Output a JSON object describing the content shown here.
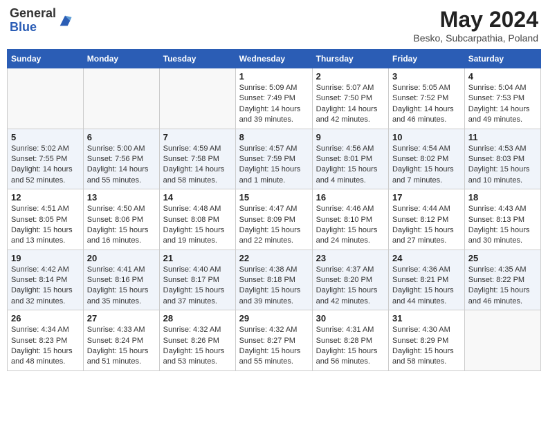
{
  "header": {
    "logo_general": "General",
    "logo_blue": "Blue",
    "month_year": "May 2024",
    "location": "Besko, Subcarpathia, Poland"
  },
  "weekdays": [
    "Sunday",
    "Monday",
    "Tuesday",
    "Wednesday",
    "Thursday",
    "Friday",
    "Saturday"
  ],
  "weeks": [
    [
      {
        "day": "",
        "info": ""
      },
      {
        "day": "",
        "info": ""
      },
      {
        "day": "",
        "info": ""
      },
      {
        "day": "1",
        "info": "Sunrise: 5:09 AM\nSunset: 7:49 PM\nDaylight: 14 hours and 39 minutes."
      },
      {
        "day": "2",
        "info": "Sunrise: 5:07 AM\nSunset: 7:50 PM\nDaylight: 14 hours and 42 minutes."
      },
      {
        "day": "3",
        "info": "Sunrise: 5:05 AM\nSunset: 7:52 PM\nDaylight: 14 hours and 46 minutes."
      },
      {
        "day": "4",
        "info": "Sunrise: 5:04 AM\nSunset: 7:53 PM\nDaylight: 14 hours and 49 minutes."
      }
    ],
    [
      {
        "day": "5",
        "info": "Sunrise: 5:02 AM\nSunset: 7:55 PM\nDaylight: 14 hours and 52 minutes."
      },
      {
        "day": "6",
        "info": "Sunrise: 5:00 AM\nSunset: 7:56 PM\nDaylight: 14 hours and 55 minutes."
      },
      {
        "day": "7",
        "info": "Sunrise: 4:59 AM\nSunset: 7:58 PM\nDaylight: 14 hours and 58 minutes."
      },
      {
        "day": "8",
        "info": "Sunrise: 4:57 AM\nSunset: 7:59 PM\nDaylight: 15 hours and 1 minute."
      },
      {
        "day": "9",
        "info": "Sunrise: 4:56 AM\nSunset: 8:01 PM\nDaylight: 15 hours and 4 minutes."
      },
      {
        "day": "10",
        "info": "Sunrise: 4:54 AM\nSunset: 8:02 PM\nDaylight: 15 hours and 7 minutes."
      },
      {
        "day": "11",
        "info": "Sunrise: 4:53 AM\nSunset: 8:03 PM\nDaylight: 15 hours and 10 minutes."
      }
    ],
    [
      {
        "day": "12",
        "info": "Sunrise: 4:51 AM\nSunset: 8:05 PM\nDaylight: 15 hours and 13 minutes."
      },
      {
        "day": "13",
        "info": "Sunrise: 4:50 AM\nSunset: 8:06 PM\nDaylight: 15 hours and 16 minutes."
      },
      {
        "day": "14",
        "info": "Sunrise: 4:48 AM\nSunset: 8:08 PM\nDaylight: 15 hours and 19 minutes."
      },
      {
        "day": "15",
        "info": "Sunrise: 4:47 AM\nSunset: 8:09 PM\nDaylight: 15 hours and 22 minutes."
      },
      {
        "day": "16",
        "info": "Sunrise: 4:46 AM\nSunset: 8:10 PM\nDaylight: 15 hours and 24 minutes."
      },
      {
        "day": "17",
        "info": "Sunrise: 4:44 AM\nSunset: 8:12 PM\nDaylight: 15 hours and 27 minutes."
      },
      {
        "day": "18",
        "info": "Sunrise: 4:43 AM\nSunset: 8:13 PM\nDaylight: 15 hours and 30 minutes."
      }
    ],
    [
      {
        "day": "19",
        "info": "Sunrise: 4:42 AM\nSunset: 8:14 PM\nDaylight: 15 hours and 32 minutes."
      },
      {
        "day": "20",
        "info": "Sunrise: 4:41 AM\nSunset: 8:16 PM\nDaylight: 15 hours and 35 minutes."
      },
      {
        "day": "21",
        "info": "Sunrise: 4:40 AM\nSunset: 8:17 PM\nDaylight: 15 hours and 37 minutes."
      },
      {
        "day": "22",
        "info": "Sunrise: 4:38 AM\nSunset: 8:18 PM\nDaylight: 15 hours and 39 minutes."
      },
      {
        "day": "23",
        "info": "Sunrise: 4:37 AM\nSunset: 8:20 PM\nDaylight: 15 hours and 42 minutes."
      },
      {
        "day": "24",
        "info": "Sunrise: 4:36 AM\nSunset: 8:21 PM\nDaylight: 15 hours and 44 minutes."
      },
      {
        "day": "25",
        "info": "Sunrise: 4:35 AM\nSunset: 8:22 PM\nDaylight: 15 hours and 46 minutes."
      }
    ],
    [
      {
        "day": "26",
        "info": "Sunrise: 4:34 AM\nSunset: 8:23 PM\nDaylight: 15 hours and 48 minutes."
      },
      {
        "day": "27",
        "info": "Sunrise: 4:33 AM\nSunset: 8:24 PM\nDaylight: 15 hours and 51 minutes."
      },
      {
        "day": "28",
        "info": "Sunrise: 4:32 AM\nSunset: 8:26 PM\nDaylight: 15 hours and 53 minutes."
      },
      {
        "day": "29",
        "info": "Sunrise: 4:32 AM\nSunset: 8:27 PM\nDaylight: 15 hours and 55 minutes."
      },
      {
        "day": "30",
        "info": "Sunrise: 4:31 AM\nSunset: 8:28 PM\nDaylight: 15 hours and 56 minutes."
      },
      {
        "day": "31",
        "info": "Sunrise: 4:30 AM\nSunset: 8:29 PM\nDaylight: 15 hours and 58 minutes."
      },
      {
        "day": "",
        "info": ""
      }
    ]
  ]
}
